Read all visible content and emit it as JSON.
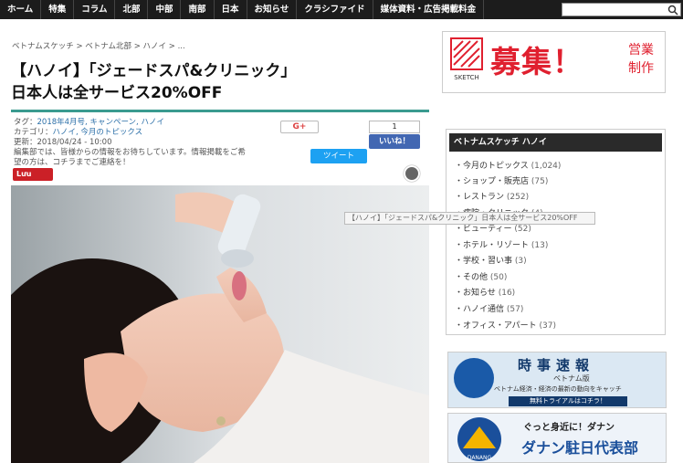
{
  "nav": {
    "items": [
      "ホーム",
      "特集",
      "コラム",
      "北部",
      "中部",
      "南部",
      "日本",
      "お知らせ",
      "クラシファイド",
      "媒体資料・広告掲載料金"
    ]
  },
  "breadcrumb": "ベトナムスケッチ > ベトナム北部 > ハノイ > ...",
  "article": {
    "title_line1": "【ハノイ】「ジェードスパ&クリニック」",
    "title_line2": "日本人は全サービス20%OFF",
    "tag_label": "タグ：",
    "tags": "2018年4月号, キャンペーン, ハノイ",
    "category_label": "カテゴリ：",
    "category": "ハノイ, 今月のトピックス",
    "updated_label": "更新：",
    "updated": "2018/04/24 - 10:00",
    "note": "編集部では、皆様からの情報をお待ちしています。情報掲載をご希望の方は、コチラまでご連絡を！"
  },
  "share": {
    "gplus": "G+",
    "fb_count": "1",
    "fb_like": "いいね！",
    "tweet": "ツイート",
    "pin": "Lưu"
  },
  "tooltip": "【ハノイ】「ジェードスパ&クリニック」日本人は全サービス20%OFF",
  "sidebar": {
    "banner1": {
      "logo_text": "SKETCH",
      "big": "募集！",
      "small1": "営業",
      "small2": "制作"
    },
    "widget_title": "ベトナムスケッチ ハノイ",
    "categories": [
      {
        "label": "今月のトピックス",
        "count": "(1,024)"
      },
      {
        "label": "ショップ・販売店",
        "count": "(75)"
      },
      {
        "label": "レストラン",
        "count": "(252)"
      },
      {
        "label": "病院・クリニック",
        "count": "(4)"
      },
      {
        "label": "ビューティー",
        "count": "(52)"
      },
      {
        "label": "ホテル・リゾート",
        "count": "(13)"
      },
      {
        "label": "学校・習い事",
        "count": "(3)"
      },
      {
        "label": "その他",
        "count": "(50)"
      },
      {
        "label": "お知らせ",
        "count": "(16)"
      },
      {
        "label": "ハノイ通信",
        "count": "(57)"
      },
      {
        "label": "オフィス・アパート",
        "count": "(37)"
      }
    ],
    "banner2": {
      "title": "時事速報",
      "sub": "ベトナム版",
      "desc": "ベトナム経済・経済の最新の動向をキャッチ",
      "cta": "無料トライアルはコチラ！"
    },
    "banner3": {
      "head": "ぐっと身近に！ダナン",
      "title": "ダナン駐日代表部",
      "logo": "DANANG"
    }
  },
  "colors": {
    "nav_bg": "#1c1c1c",
    "accent": "#3a9b8f",
    "red": "#e0202f",
    "fb": "#4267b2",
    "tw": "#1da1f2"
  }
}
